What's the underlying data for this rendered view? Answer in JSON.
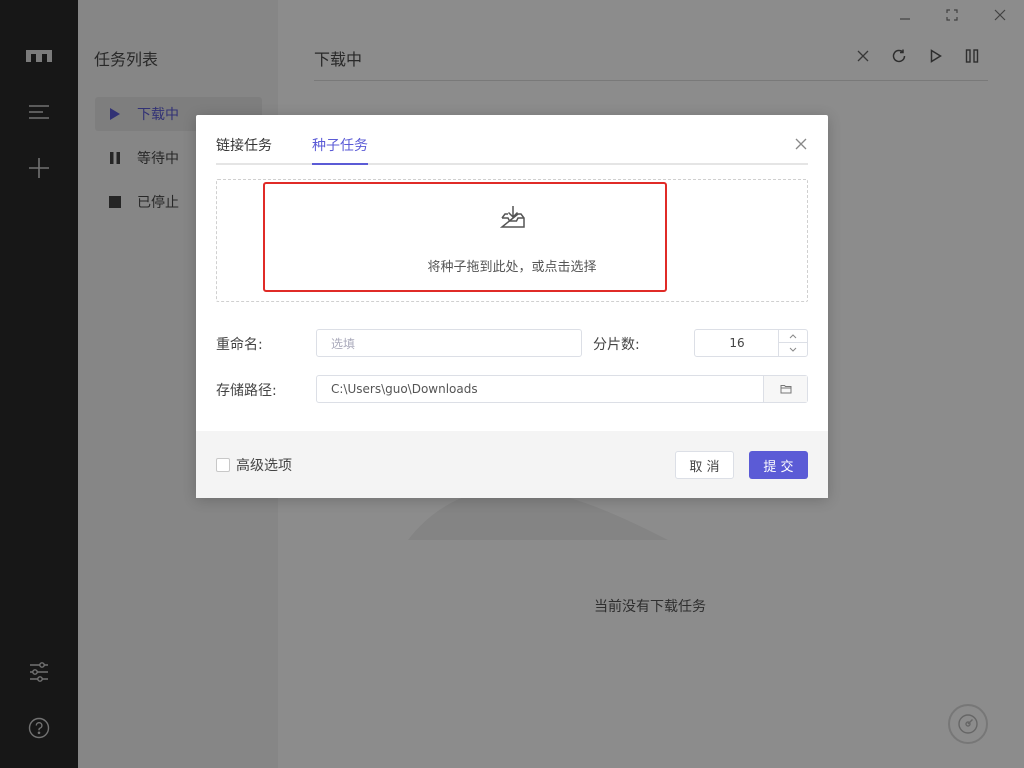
{
  "app": {
    "rail_icons": [
      "logo-icon",
      "menu-icon",
      "plus-icon",
      "settings-sliders-icon",
      "help-icon"
    ]
  },
  "sidebar": {
    "title": "任务列表",
    "items": [
      {
        "label": "下载中",
        "icon": "play-icon",
        "active": true
      },
      {
        "label": "等待中",
        "icon": "pause-icon",
        "active": false
      },
      {
        "label": "已停止",
        "icon": "stop-icon",
        "active": false
      }
    ]
  },
  "main": {
    "title": "下载中",
    "toolbar": [
      "close-icon",
      "refresh-icon",
      "play-icon",
      "pause-all-icon"
    ],
    "empty_text": "当前没有下载任务"
  },
  "window_controls": [
    "minimize-icon",
    "maximize-icon",
    "close-icon"
  ],
  "dialog": {
    "tabs": [
      {
        "label": "链接任务",
        "active": false
      },
      {
        "label": "种子任务",
        "active": true
      }
    ],
    "drop_zone": {
      "text": "将种子拖到此处，或点击选择"
    },
    "rename": {
      "label": "重命名:",
      "placeholder": "选填",
      "value": ""
    },
    "split": {
      "label": "分片数:",
      "value": "16"
    },
    "path": {
      "label": "存储路径:",
      "value": "C:\\Users\\guo\\Downloads"
    },
    "advanced_label": "高级选项",
    "cancel_label": "取 消",
    "submit_label": "提 交"
  },
  "colors": {
    "accent": "#5b5bd6",
    "rail_bg": "#2a2a2a",
    "sidebar_bg": "#f4f4f4",
    "highlight": "#e02b27"
  }
}
